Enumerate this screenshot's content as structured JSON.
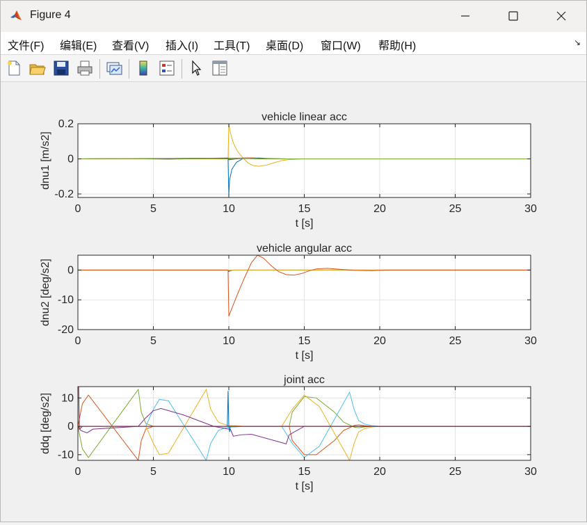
{
  "window": {
    "title": "Figure 4"
  },
  "menu": [
    "文件(F)",
    "编辑(E)",
    "查看(V)",
    "插入(I)",
    "工具(T)",
    "桌面(D)",
    "窗口(W)",
    "帮助(H)"
  ],
  "toolbar": [
    "new-figure",
    "open-file",
    "save",
    "print",
    "link-plot",
    "insert-colorbar",
    "insert-legend",
    "edit-plot",
    "property-inspector"
  ],
  "colors": {
    "series": [
      "#0072BD",
      "#D95319",
      "#EDB120",
      "#7E2F8E",
      "#77AC30",
      "#4DBEEE",
      "#A2142F"
    ],
    "background": "#f0f0f0",
    "axes": "#ffffff",
    "grid": "#e3e3e3"
  },
  "chart_data": [
    {
      "type": "line",
      "title": "vehicle linear acc",
      "xlabel": "t [s]",
      "ylabel": "dnu1 [m/s2]",
      "xlim": [
        0,
        30
      ],
      "ylim": [
        -0.22,
        0.2
      ],
      "xticks": [
        0,
        5,
        10,
        15,
        20,
        25,
        30
      ],
      "yticks": [
        -0.2,
        0,
        0.2
      ],
      "ytick_labels": [
        "-0.2",
        "0",
        "0.2"
      ],
      "grid": true,
      "series": [
        {
          "color": "#0072BD",
          "x": [
            0,
            9.95,
            10,
            10.05,
            10.2,
            10.5,
            11,
            12,
            13,
            30
          ],
          "y": [
            0,
            0,
            -0.21,
            -0.12,
            -0.06,
            -0.02,
            0.005,
            0.005,
            0,
            0
          ]
        },
        {
          "color": "#D95319",
          "x": [
            0,
            9.5,
            10,
            11,
            11.5,
            12,
            13,
            14,
            30
          ],
          "y": [
            0,
            0.003,
            0.004,
            0.005,
            0.006,
            0.003,
            0.002,
            0,
            0
          ]
        },
        {
          "color": "#EDB120",
          "x": [
            0,
            9.95,
            10,
            10.1,
            10.3,
            10.6,
            11,
            11.3,
            11.6,
            12,
            12.5,
            13,
            13.5,
            14,
            15,
            30
          ],
          "y": [
            0,
            0,
            0.2,
            0.15,
            0.09,
            0.04,
            0,
            -0.025,
            -0.038,
            -0.042,
            -0.035,
            -0.022,
            -0.01,
            -0.004,
            0,
            0
          ]
        },
        {
          "color": "#7E2F8E",
          "x": [
            0,
            6,
            9,
            9.95,
            10,
            10.5,
            11,
            12,
            13,
            30
          ],
          "y": [
            0,
            0.002,
            0.004,
            0.005,
            -0.005,
            0,
            0.003,
            0.002,
            0,
            0
          ]
        },
        {
          "color": "#77AC30",
          "x": [
            0,
            3,
            6,
            9,
            10,
            11,
            12,
            30
          ],
          "y": [
            0,
            0.002,
            -0.002,
            0.002,
            0,
            0.003,
            0,
            0
          ]
        }
      ]
    },
    {
      "type": "line",
      "title": "vehicle angular acc",
      "xlabel": "t [s]",
      "ylabel": "dnu2 [deg/s2]",
      "xlim": [
        0,
        30
      ],
      "ylim": [
        -20,
        5
      ],
      "xticks": [
        0,
        5,
        10,
        15,
        20,
        25,
        30
      ],
      "yticks": [
        -20,
        -10,
        0
      ],
      "ytick_labels": [
        "-20",
        "-10",
        "0"
      ],
      "grid": true,
      "series": [
        {
          "color": "#0072BD",
          "x": [
            0,
            9.95,
            10,
            10.1,
            10.3,
            30
          ],
          "y": [
            0,
            0,
            -0.5,
            -0.2,
            0,
            0
          ]
        },
        {
          "color": "#EDB120",
          "x": [
            0,
            30
          ],
          "y": [
            0,
            0
          ]
        },
        {
          "color": "#D95319",
          "x": [
            0,
            9.95,
            10,
            10.5,
            11,
            11.5,
            11.9,
            12.3,
            12.8,
            13.3,
            13.8,
            14.3,
            14.8,
            15.3,
            15.8,
            16.5,
            17.5,
            18.5,
            19.5,
            20.5,
            30
          ],
          "y": [
            0,
            0,
            -15.5,
            -9,
            -3,
            2.5,
            5,
            4,
            1.5,
            -0.5,
            -1.5,
            -1.7,
            -1.2,
            -0.3,
            0.4,
            0.6,
            0.2,
            -0.1,
            -0.2,
            0,
            0
          ]
        }
      ]
    },
    {
      "type": "line",
      "title": "joint acc",
      "xlabel": "t [s]",
      "ylabel": "ddq [deg/s2]",
      "xlim": [
        0,
        30
      ],
      "ylim": [
        -12,
        14
      ],
      "xticks": [
        0,
        5,
        10,
        15,
        20,
        25,
        30
      ],
      "yticks": [
        -10,
        0,
        10
      ],
      "ytick_labels": [
        "-10",
        "0",
        "10"
      ],
      "grid": true,
      "series": [
        {
          "color": "#D95319",
          "x": [
            0,
            0.3,
            0.7,
            4,
            4.2,
            4.5,
            5,
            14,
            14.2,
            15,
            15.8,
            17,
            17.6,
            18,
            18.3,
            18.6,
            19,
            19.5,
            20,
            30
          ],
          "y": [
            0,
            8,
            11,
            -12,
            -5,
            -1,
            0,
            0,
            -5,
            -10,
            -10,
            -5,
            -1.5,
            -0.5,
            0.3,
            0.5,
            0.2,
            0,
            0,
            0
          ]
        },
        {
          "color": "#77AC30",
          "x": [
            0,
            0.3,
            0.7,
            4,
            4.2,
            4.5,
            5,
            14,
            14.2,
            15,
            15.8,
            17,
            17.6,
            18,
            18.3,
            18.6,
            19,
            19.5,
            20,
            30
          ],
          "y": [
            0,
            -8,
            -11,
            13,
            5,
            1,
            0,
            0,
            5,
            10.5,
            10,
            5,
            1.5,
            0.5,
            -0.3,
            -0.5,
            -0.2,
            0,
            0,
            0
          ]
        },
        {
          "color": "#EDB120",
          "x": [
            0,
            4.5,
            5,
            5.4,
            6,
            8.5,
            8.8,
            9.3,
            9.8,
            10,
            10.5,
            11,
            12,
            13.5,
            14.2,
            15,
            16,
            18,
            18.3,
            18.6,
            19,
            19.5,
            20,
            30
          ],
          "y": [
            0,
            0,
            -6,
            -10,
            -9.5,
            13,
            6,
            1.5,
            0.5,
            0.3,
            0.2,
            0,
            0,
            0,
            6,
            11,
            7,
            -12,
            -6,
            -2,
            -0.8,
            -0.2,
            0,
            0
          ]
        },
        {
          "color": "#4DBEEE",
          "x": [
            0,
            4.5,
            5,
            5.4,
            6,
            8.5,
            8.8,
            9.3,
            9.8,
            10,
            10.5,
            11,
            12,
            13.5,
            14.2,
            15,
            16,
            18,
            18.3,
            18.6,
            19,
            19.5,
            20,
            30
          ],
          "y": [
            0,
            0,
            6,
            9.5,
            9,
            -12,
            -6,
            -1.5,
            -0.5,
            -0.3,
            -0.2,
            0,
            0,
            0,
            -6,
            -11,
            -7,
            12,
            6,
            2,
            0.8,
            0.2,
            0,
            0
          ]
        },
        {
          "color": "#7E2F8E",
          "x": [
            0,
            0.2,
            0.6,
            1,
            4,
            4.5,
            5,
            5.5,
            7,
            9,
            10,
            10.1,
            10.3,
            10.8,
            11.5,
            13,
            13.8,
            14,
            15,
            16,
            17,
            18,
            30
          ],
          "y": [
            0,
            -1.5,
            -2.3,
            -1,
            0,
            3,
            5.5,
            6.3,
            4,
            0,
            -1,
            -1,
            -3.5,
            -3,
            -2.8,
            -5,
            -6.2,
            -3,
            0,
            0,
            0,
            0,
            0
          ]
        },
        {
          "color": "#0072BD",
          "x": [
            0,
            9.9,
            9.95,
            10,
            10.05,
            10.1,
            30
          ],
          "y": [
            0,
            0,
            12.5,
            0,
            -2,
            0,
            0
          ]
        },
        {
          "color": "#A2142F",
          "x": [
            0,
            0.05,
            0.1,
            0.3,
            30
          ],
          "y": [
            14,
            14,
            -1,
            0,
            0
          ]
        }
      ]
    }
  ]
}
